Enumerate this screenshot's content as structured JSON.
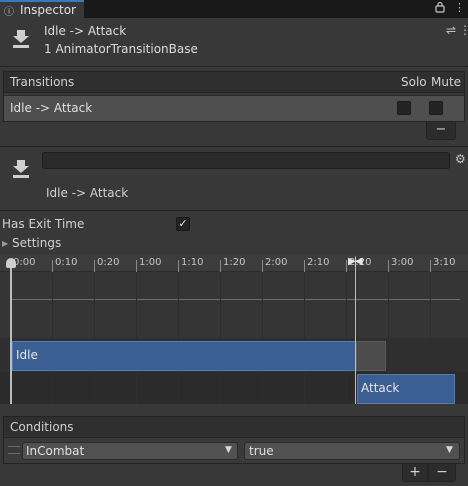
{
  "tab": {
    "label": "Inspector",
    "icon": "info-icon"
  },
  "header": {
    "title": "Idle -> Attack",
    "subtitle": "1 AnimatorTransitionBase",
    "icon": "transition-icon"
  },
  "transitions": {
    "title": "Transitions",
    "solo_label": "Solo",
    "mute_label": "Mute",
    "items": [
      {
        "label": "Idle -> Attack",
        "solo": false,
        "mute": false
      }
    ],
    "remove_label": "−"
  },
  "name_section": {
    "name_value": "",
    "label": "Idle -> Attack"
  },
  "properties": {
    "has_exit_time_label": "Has Exit Time",
    "has_exit_time": true,
    "settings_label": "Settings"
  },
  "timeline": {
    "ticks": [
      "0:00",
      "0:10",
      "0:20",
      "1:00",
      "1:10",
      "1:20",
      "2:00",
      "2:10",
      "2:20",
      "3:00",
      "3:10"
    ],
    "source_state": "Idle",
    "destination_state": "Attack"
  },
  "conditions": {
    "title": "Conditions",
    "items": [
      {
        "parameter": "InCombat",
        "value": "true"
      }
    ],
    "add_label": "+",
    "remove_label": "−"
  },
  "colors": {
    "background": "#383838",
    "tab_accent": "#3a79bb",
    "state_bar": "#3b5f92"
  }
}
